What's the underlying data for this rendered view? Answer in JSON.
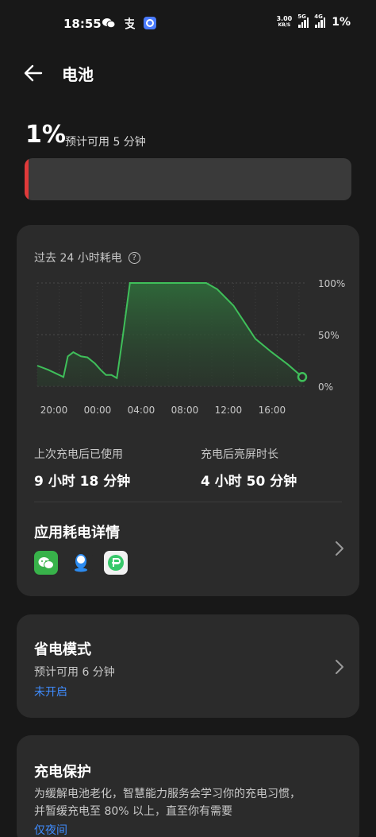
{
  "status_bar": {
    "time": "18:55",
    "left_icons": [
      "wechat-icon",
      "alipay-icon",
      "browser-icon"
    ],
    "net_speed_value": "3.00",
    "net_speed_unit": "KB/S",
    "signal1_tag": "5G",
    "signal2_tag": "4G",
    "battery": "1%"
  },
  "header": {
    "title": "电池"
  },
  "battery": {
    "level": "1%",
    "estimate": "预计可用 5 分钟",
    "level_fraction": 0.01,
    "fill_color": "#e03a3a"
  },
  "usage_card": {
    "title": "过去 24 小时耗电",
    "y_tick_labels": [
      "100%",
      "50%",
      "0%"
    ],
    "x_tick_labels": [
      "20:00",
      "00:00",
      "04:00",
      "08:00",
      "12:00",
      "16:00"
    ],
    "stat_left_label": "上次充电后已使用",
    "stat_left_value": "9 小时 18 分钟",
    "stat_right_label": "充电后亮屏时长",
    "stat_right_value": "4 小时 50 分钟",
    "apps_title": "应用耗电详情",
    "apps": [
      "wechat-icon",
      "qq-icon",
      "green-app-icon"
    ]
  },
  "chart_data": {
    "type": "area",
    "title": "过去 24 小时耗电",
    "xlabel": "",
    "ylabel": "",
    "x_ticks": [
      "20:00",
      "00:00",
      "04:00",
      "08:00",
      "12:00",
      "16:00"
    ],
    "y_ticks": [
      "100%",
      "50%",
      "0%"
    ],
    "ylim": [
      0,
      100
    ],
    "x_hours_from_start": [
      0,
      1,
      2,
      2.4,
      2.8,
      3.3,
      4,
      4.6,
      5.3,
      5.8,
      6.3,
      6.8,
      7.3,
      7.8,
      8.5,
      9.0,
      9.2,
      11,
      13,
      15.5,
      16.5,
      18,
      19,
      20,
      21.5,
      23,
      24.3
    ],
    "values": [
      20,
      16,
      11,
      9,
      29,
      33,
      29,
      28,
      22,
      16,
      11,
      11,
      8,
      45,
      100,
      100,
      100,
      100,
      100,
      100,
      94,
      78,
      62,
      46,
      33,
      21,
      9
    ],
    "series_color": "#3fbf5a",
    "grid": false
  },
  "saver_card": {
    "title": "省电模式",
    "estimate": "预计可用 6 分钟",
    "status": "未开启"
  },
  "protect_card": {
    "title": "充电保护",
    "desc_line1": "为缓解电池老化，智慧能力服务会学习你的充电习惯，",
    "desc_line2": "并暂缓充电至 80% 以上，直至你有需要",
    "status": "仅夜间"
  }
}
